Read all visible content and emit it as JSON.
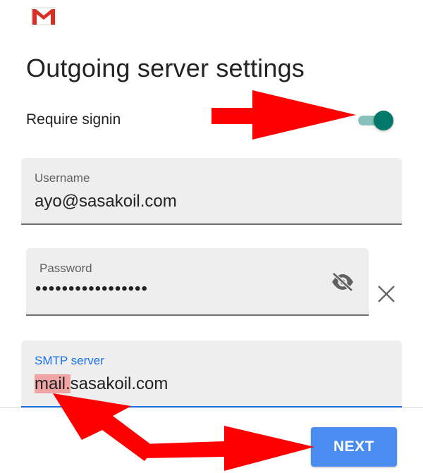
{
  "header": {
    "logo_icon": "gmail-logo-icon",
    "title": "Outgoing server settings"
  },
  "signin": {
    "label": "Require signin",
    "enabled": true,
    "accent_color": "#00796b"
  },
  "username": {
    "label": "Username",
    "value": "ayo@sasakoil.com"
  },
  "password": {
    "label": "Password",
    "value": "•••••••••••••••••",
    "visibility_icon": "visibility-off-icon",
    "clear_icon": "close-icon"
  },
  "smtp": {
    "label": "SMTP server",
    "value_highlighted": "mail.",
    "value_rest": "sasakoil.com",
    "accent_color": "#1a73e8"
  },
  "footer": {
    "next_label": "NEXT",
    "button_color": "#4a8cf0"
  },
  "annotations": {
    "arrow_color": "#ff0000",
    "highlight_color": "#f0a4a4"
  }
}
